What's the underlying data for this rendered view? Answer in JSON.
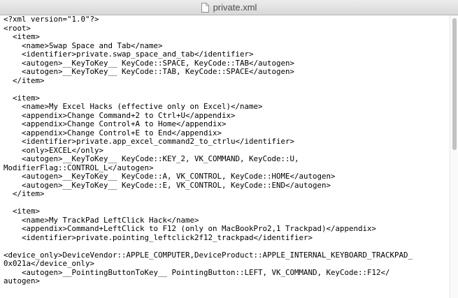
{
  "window": {
    "title": "private.xml",
    "icon": "document-icon"
  },
  "editor": {
    "lines": [
      "<?xml version=\"1.0\"?>",
      "<root>",
      "  <item>",
      "    <name>Swap Space and Tab</name>",
      "    <identifier>private.swap_space_and_tab</identifier>",
      "    <autogen>__KeyToKey__ KeyCode::SPACE, KeyCode::TAB</autogen>",
      "    <autogen>__KeyToKey__ KeyCode::TAB, KeyCode::SPACE</autogen>",
      "  </item>",
      "",
      "  <item>",
      "    <name>My Excel Hacks (effective only on Excel)</name>",
      "    <appendix>Change Command+2 to Ctrl+U</appendix>",
      "    <appendix>Change Control+A to Home</appendix>",
      "    <appendix>Change Control+E to End</appendix>",
      "    <identifier>private.app_excel_command2_to_ctrlu</identifier>",
      "    <only>EXCEL</only>",
      "    <autogen>__KeyToKey__ KeyCode::KEY_2, VK_COMMAND, KeyCode::U,",
      "ModifierFlag::CONTROL_L</autogen>",
      "    <autogen>__KeyToKey__ KeyCode::A, VK_CONTROL, KeyCode::HOME</autogen>",
      "    <autogen>__KeyToKey__ KeyCode::E, VK_CONTROL, KeyCode::END</autogen>",
      "  </item>",
      "",
      "  <item>",
      "    <name>My TrackPad LeftClick Hack</name>",
      "    <appendix>Command+LeftClick to F12 (only on MacBookPro2,1 Trackpad)</appendix>",
      "    <identifier>private.pointing_leftclick2f12_trackpad</identifier>",
      "",
      "<device_only>DeviceVendor::APPLE_COMPUTER,DeviceProduct::APPLE_INTERNAL_KEYBOARD_TRACKPAD_",
      "0x021a</device_only>",
      "    <autogen>__PointingButtonToKey__ PointingButton::LEFT, VK_COMMAND, KeyCode::F12</",
      "autogen>"
    ]
  }
}
